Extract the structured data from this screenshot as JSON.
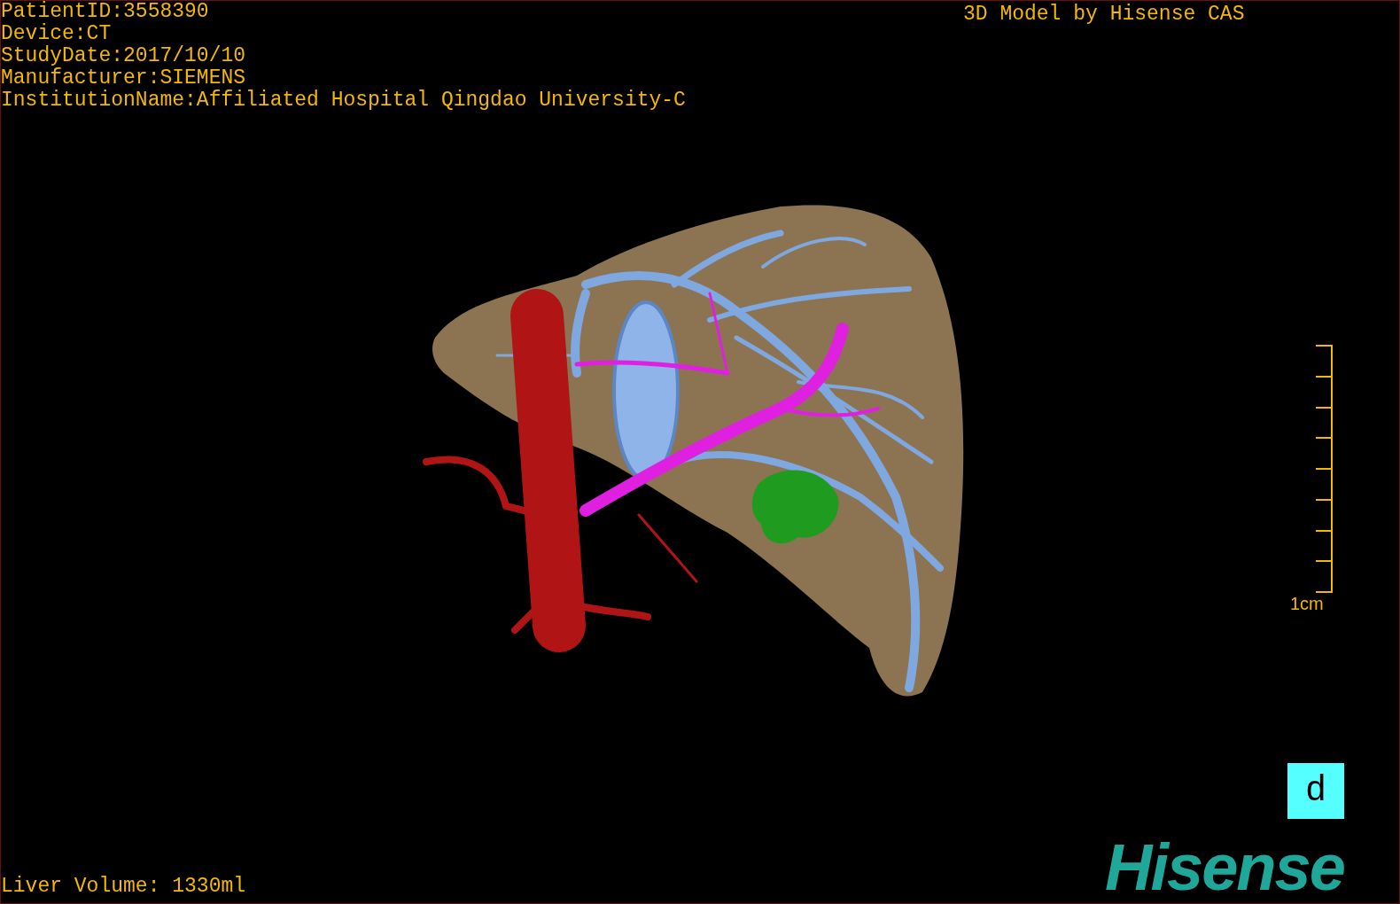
{
  "study_info": [
    "PatientID:3558390",
    "Device:CT",
    "StudyDate:2017/10/10",
    "Manufacturer:SIEMENS",
    "InstitutionName:Affiliated Hospital Qingdao University-C"
  ],
  "model_credit": "3D Model by Hisense CAS",
  "scale_bar": {
    "label": "1cm"
  },
  "view_label": "d",
  "liver_volume": "Liver Volume: 1330ml",
  "logo": "Hisense"
}
